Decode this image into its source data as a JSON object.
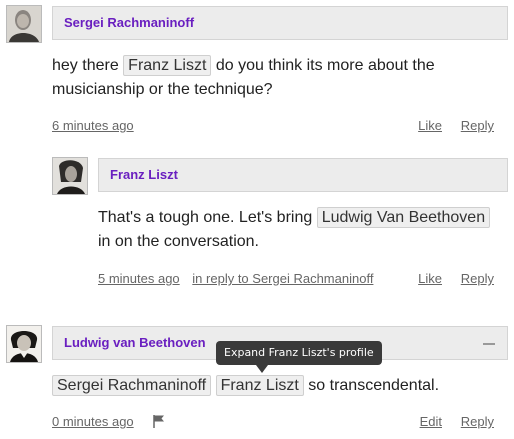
{
  "comments": [
    {
      "author": "Sergei Rachmaninoff",
      "avatar_icon": "portrait-avatar-rachmaninoff",
      "text_before": "hey there",
      "mention": "Franz Liszt",
      "text_after": "do you think its more about the",
      "text_line2": "musicianship or the technique?",
      "time": "6 minutes ago",
      "like": "Like",
      "reply": "Reply"
    },
    {
      "author": "Franz Liszt",
      "avatar_icon": "portrait-avatar-liszt",
      "text_before": "That's a tough one. Let's bring",
      "mention": "Ludwig Van Beethoven",
      "text_line2": "in on the conversation.",
      "time": "5 minutes ago",
      "in_reply_to": "in reply to Sergei Rachmaninoff",
      "like": "Like",
      "reply": "Reply"
    },
    {
      "author": "Ludwig van Beethoven",
      "avatar_icon": "portrait-avatar-beethoven",
      "mention_1": "Sergei Rachmaninoff",
      "mention_2": "Franz Liszt",
      "text_after": "so transcendental.",
      "time": "0 minutes ago",
      "flag_icon": "flag-icon",
      "edit": "Edit",
      "reply": "Reply",
      "tooltip": "Expand Franz Liszt's profile"
    }
  ]
}
